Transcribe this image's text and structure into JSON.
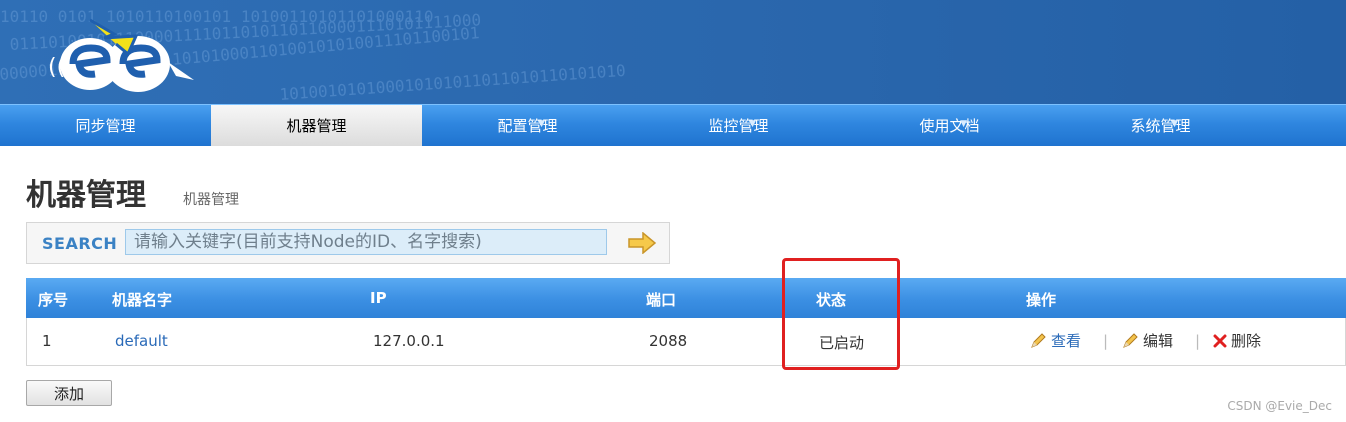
{
  "nav": {
    "items": [
      {
        "label": "同步管理",
        "dropdown": false
      },
      {
        "label": "机器管理",
        "dropdown": false,
        "active": true
      },
      {
        "label": "配置管理",
        "dropdown": true
      },
      {
        "label": "监控管理",
        "dropdown": true
      },
      {
        "label": "使用文档",
        "dropdown": true
      },
      {
        "label": "系统管理",
        "dropdown": true
      }
    ]
  },
  "page": {
    "title": "机器管理",
    "breadcrumb": "机器管理"
  },
  "search": {
    "label": "SEARCH",
    "placeholder": "请输入关键字(目前支持Node的ID、名字搜索)"
  },
  "table": {
    "headers": [
      "序号",
      "机器名字",
      "IP",
      "端口",
      "状态",
      "操作"
    ],
    "rows": [
      {
        "index": "1",
        "name": "default",
        "ip": "127.0.0.1",
        "port": "2088",
        "status": "已启动",
        "actions": {
          "view": "查看",
          "edit": "编辑",
          "delete": "删除"
        }
      }
    ]
  },
  "buttons": {
    "add": "添加"
  },
  "watermark": "CSDN @Evie_Dec",
  "colors": {
    "nav_blue": "#2f86df",
    "highlight_red": "#e02020",
    "link_blue": "#2a6ab8"
  }
}
